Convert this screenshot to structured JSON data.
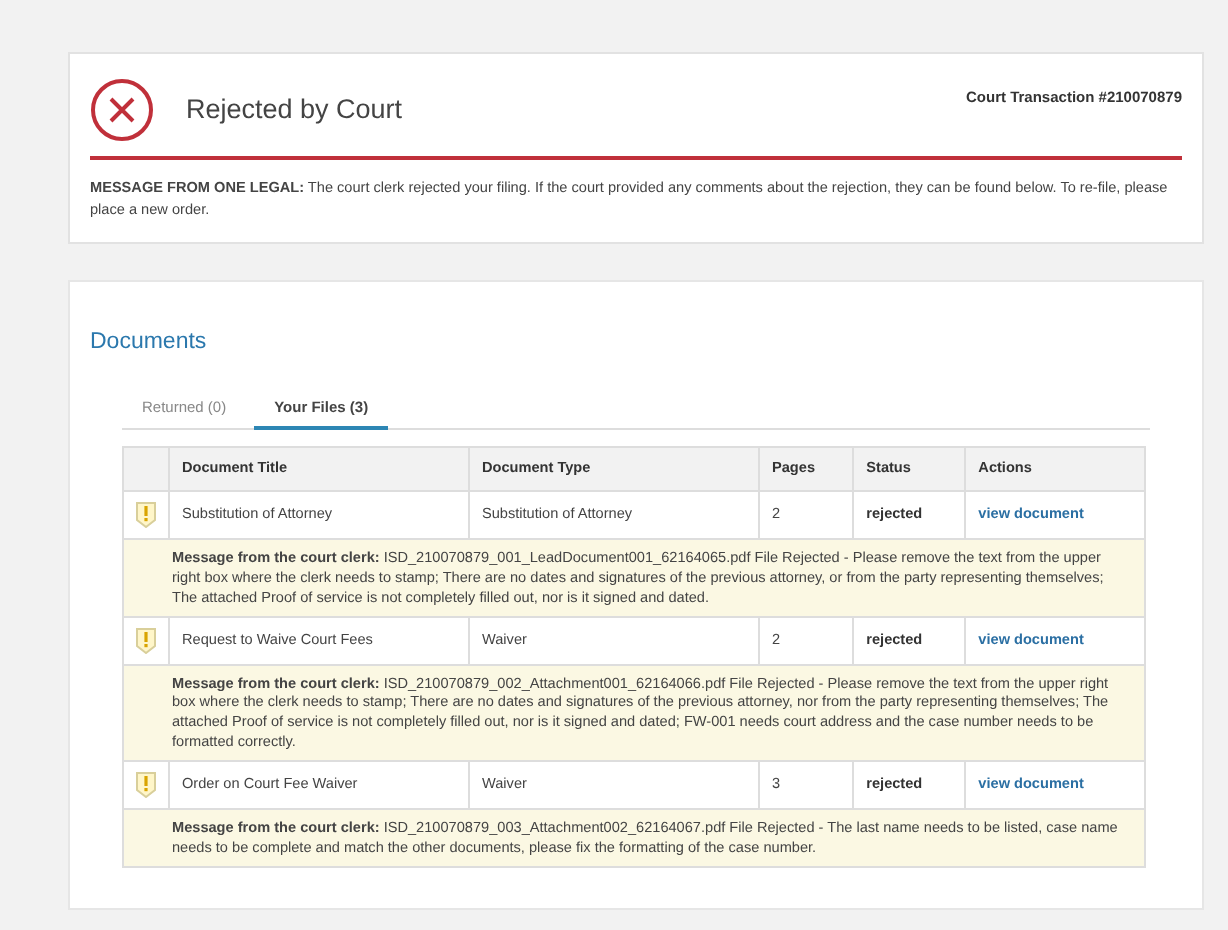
{
  "notice": {
    "title": "Rejected by Court",
    "transaction": "Court Transaction #210070879",
    "message": "**MESSAGE FROM ONE LEGAL:** The court clerk rejected your filing. If the court provided any comments about the rejection, they can be found below. To re-file, please place a new order."
  },
  "documents": {
    "title": "Documents",
    "tabs": [
      {
        "label": "Returned (0)",
        "selected": false
      },
      {
        "label": "Your Files (3)",
        "selected": true
      }
    ],
    "table": {
      "columns": [
        "Document Title",
        "Document Type",
        "Pages",
        "Status",
        "Actions"
      ],
      "rows": [
        {
          "title": "Substitution of Attorney",
          "type": "Substitution of Attorney",
          "pages": "2",
          "status": "rejected",
          "action": "view document",
          "message": "**Message from the court clerk:** ISD_210070879_001_LeadDocument001_62164065.pdf File Rejected - Please remove the text from the upper right box where the clerk needs to stamp; There are no dates and signatures of the previous attorney, or from the party representing themselves; The attached Proof of service is not completely filled out, nor is it signed and dated."
        },
        {
          "title": "Request to Waive Court Fees",
          "type": "Waiver",
          "pages": "2",
          "status": "rejected",
          "action": "view document",
          "message": "**Message from the court clerk:** ISD_210070879_002_Attachment001_62164066.pdf File Rejected - Please remove the text from the upper right box where the clerk needs to stamp; There are no dates and signatures of the previous attorney, nor from the party representing themselves; The attached Proof of service is not completely filled out, nor is it signed and dated; FW-001 needs court address and the case number needs to be formatted correctly."
        },
        {
          "title": "Order on Court Fee Waiver",
          "type": "Waiver",
          "pages": "3",
          "status": "rejected",
          "action": "view document",
          "message": "**Message from the court clerk:** ISD_210070879_003_Attachment002_62164067.pdf File Rejected - The last name needs to be listed, case name needs to be complete and match the other documents, please fix the formatting of the case number."
        }
      ]
    }
  }
}
